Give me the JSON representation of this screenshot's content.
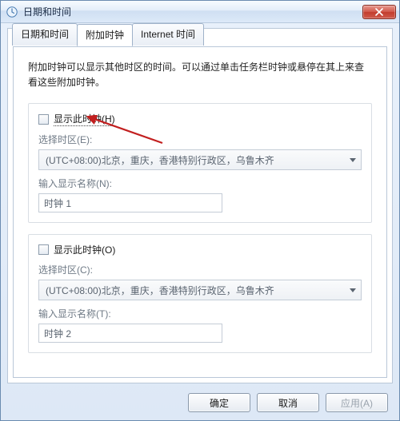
{
  "window": {
    "title": "日期和时间"
  },
  "tabs": {
    "t0": "日期和时间",
    "t1": "附加时钟",
    "t2": "Internet 时间",
    "active_index": 1
  },
  "description": "附加时钟可以显示其他时区的时间。可以通过单击任务栏时钟或悬停在其上来查看这些附加时钟。",
  "clock1": {
    "checkbox_label": "显示此时钟(H)",
    "checked": false,
    "tz_label": "选择时区(E):",
    "tz_value": "(UTC+08:00)北京，重庆，香港特别行政区，乌鲁木齐",
    "name_label": "输入显示名称(N):",
    "name_value": "时钟 1"
  },
  "clock2": {
    "checkbox_label": "显示此时钟(O)",
    "checked": false,
    "tz_label": "选择时区(C):",
    "tz_value": "(UTC+08:00)北京，重庆，香港特别行政区，乌鲁木齐",
    "name_label": "输入显示名称(T):",
    "name_value": "时钟 2"
  },
  "buttons": {
    "ok": "确定",
    "cancel": "取消",
    "apply": "应用(A)"
  },
  "colors": {
    "close_red": "#c94a3b",
    "annotation_red": "#c21f1f"
  }
}
